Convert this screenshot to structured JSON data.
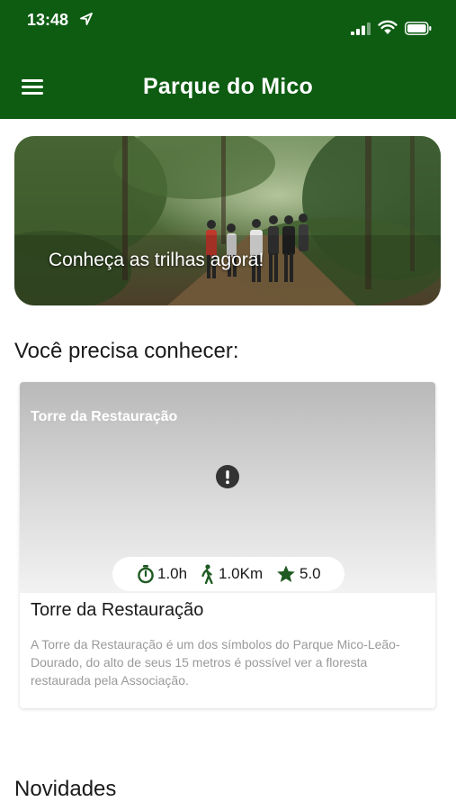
{
  "status_bar": {
    "time": "13:48",
    "icons": [
      "location-arrow-icon",
      "signal-icon",
      "wifi-icon",
      "battery-icon"
    ]
  },
  "header": {
    "title": "Parque do Mico",
    "menu_icon": "hamburger-menu-icon",
    "background_color": "#0d5c12"
  },
  "hero": {
    "text": "Conheça as trilhas agora!"
  },
  "sections": {
    "featured_title": "Você precisa conhecer:",
    "news_title": "Novidades"
  },
  "featured_card": {
    "image_title": "Torre da Restauração",
    "image_status_icon": "error-icon",
    "stats": {
      "duration": "1.0h",
      "distance": "1.0Km",
      "rating": "5.0"
    },
    "title": "Torre da Restauração",
    "description": "A Torre da Restauração é um dos símbolos do Parque Mico-Leão-Dourado, do alto de seus 15 metros é possível ver a floresta restaurada pela Associação."
  },
  "colors": {
    "primary": "#0d5c12",
    "icon_green": "#1e5a22",
    "description_text": "#9a9a9a"
  }
}
